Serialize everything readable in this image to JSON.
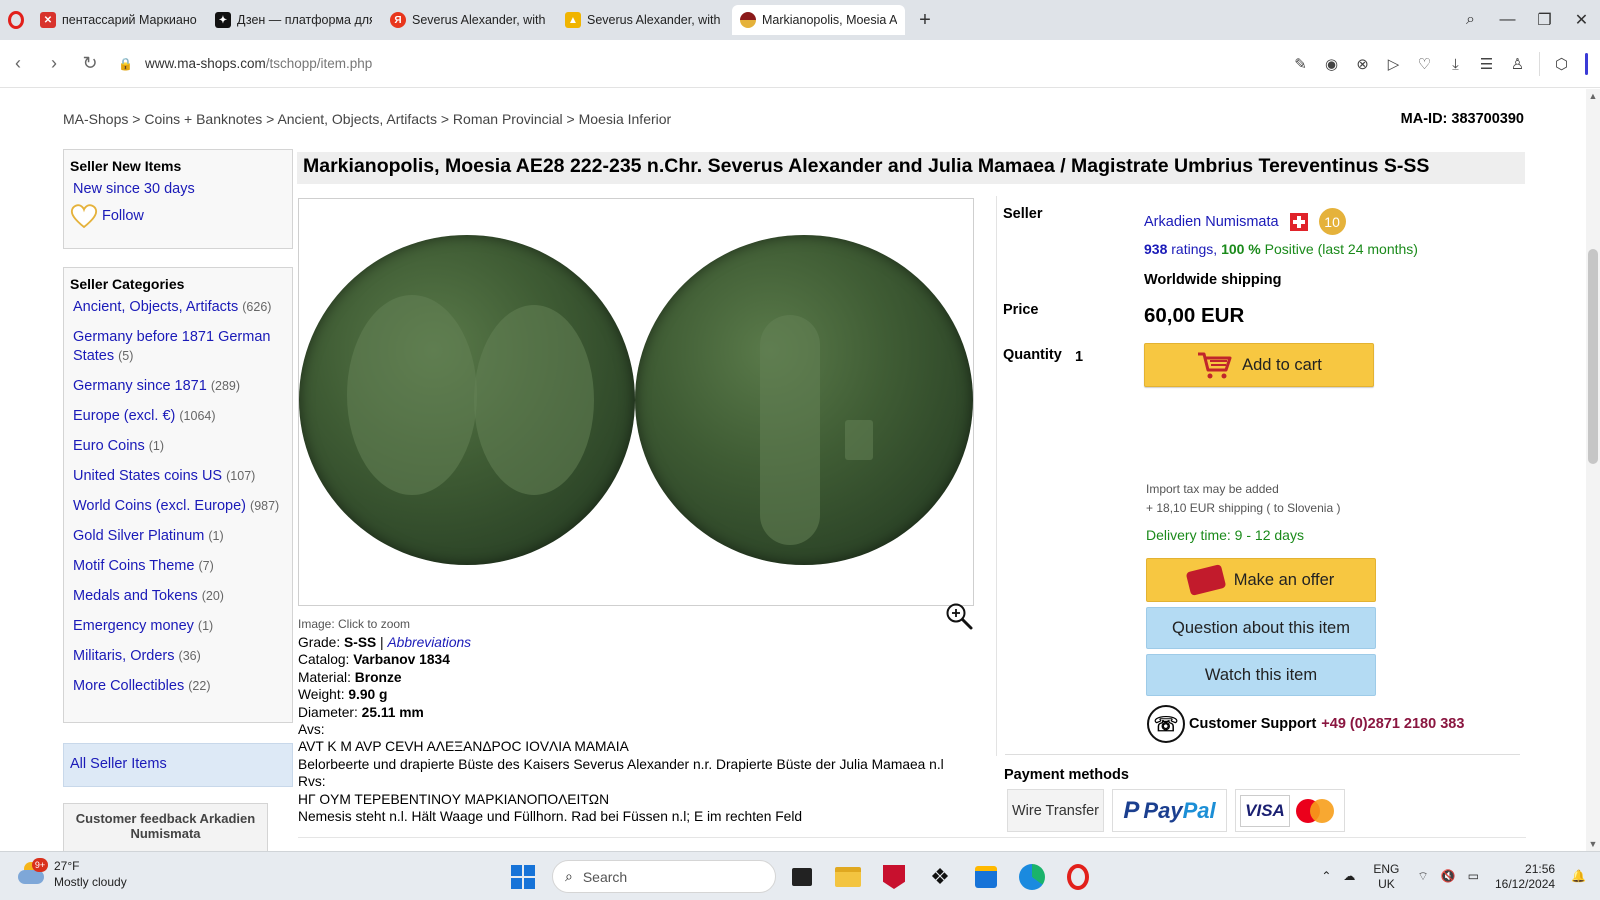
{
  "browser": {
    "tabs": [
      {
        "label": "пентассарий Маркиано",
        "favicon_color": "#d8332c",
        "active": false
      },
      {
        "label": "Дзен — платформа для п",
        "favicon_color": "#111111",
        "active": false
      },
      {
        "label": "Severus Alexander, with Ju",
        "favicon_color": "#e8361c",
        "active": false
      },
      {
        "label": "Severus Alexander, with Ju",
        "favicon_color": "#f0b400",
        "active": false
      },
      {
        "label": "Markianopolis, Moesia AE",
        "favicon_color": "#8b1a1a",
        "active": true
      }
    ],
    "url_host": "www.ma-shops.com",
    "url_path": "/tschopp/item.php"
  },
  "breadcrumb": {
    "items": [
      "MA-Shops",
      "Coins + Banknotes",
      "Ancient, Objects, Artifacts",
      "Roman Provincial",
      "Moesia Inferior"
    ],
    "separator": ">"
  },
  "ma_id": "MA-ID: 383700390",
  "seller_new_items": {
    "title": "Seller New Items",
    "new_since": "New since 30 days",
    "follow": "Follow"
  },
  "seller_categories": {
    "title": "Seller Categories",
    "items": [
      {
        "name": "Ancient, Objects, Artifacts",
        "count": "(626)"
      },
      {
        "name": "Germany before 1871 German States",
        "count": "(5)"
      },
      {
        "name": "Germany since 1871",
        "count": "(289)"
      },
      {
        "name": "Europe (excl. €)",
        "count": "(1064)"
      },
      {
        "name": "Euro Coins",
        "count": "(1)"
      },
      {
        "name": "United States coins US",
        "count": "(107)"
      },
      {
        "name": "World Coins (excl. Europe)",
        "count": "(987)"
      },
      {
        "name": "Gold Silver Platinum",
        "count": "(1)"
      },
      {
        "name": "Motif Coins Theme",
        "count": "(7)"
      },
      {
        "name": "Medals and Tokens",
        "count": "(20)"
      },
      {
        "name": "Emergency money",
        "count": "(1)"
      },
      {
        "name": "Militaris, Orders",
        "count": "(36)"
      },
      {
        "name": "More Collectibles",
        "count": "(22)"
      }
    ]
  },
  "all_seller_items": "All Seller Items",
  "customer_feedback": "Customer feedback Arkadien Numismata",
  "item": {
    "title": "Markianopolis, Moesia AE28 222-235 n.Chr. Severus Alexander and Julia Mamaea / Magistrate Umbrius Tereventinus S-SS",
    "image_caption": "Image: Click to zoom",
    "grade_label": "Grade: ",
    "grade_value": "S-SS",
    "grade_sep": " | ",
    "abbreviations": "Abbreviations",
    "catalog_label": "Catalog: ",
    "catalog_value": "Varbanov 1834",
    "material_label": "Material: ",
    "material_value": "Bronze",
    "weight_label": "Weight: ",
    "weight_value": "9.90 g",
    "diameter_label": "Diameter: ",
    "diameter_value": "25.11 mm",
    "avs_label": "Avs:",
    "avs_legend": "AVT K M AVP CEVH AΛEΞANΔPOC IOVΛIA MAMAIA",
    "avs_desc": "Belorbeerte und drapierte Büste des Kaisers Severus Alexander n.r. Drapierte Büste der Julia Mamaea n.l",
    "rvs_label": "Rvs:",
    "rvs_legend": "HΓ OYM TEPEBENTINOY MAPKIANOΠOΛEITΩN",
    "rvs_desc": "Nemesis steht n.l. Hält Waage und Füllhorn. Rad bei Füssen n.l; E im rechten Feld"
  },
  "seller": {
    "label": "Seller",
    "name": "Arkadien Numismata",
    "badge": "10",
    "ratings_count": "938",
    "ratings_word": " ratings, ",
    "positive_pct": "100 %",
    "positive_text": " Positive (last 24 months)",
    "worldwide": "Worldwide shipping"
  },
  "purchase": {
    "price_label": "Price",
    "price": "60,00 EUR",
    "quantity_label": "Quantity",
    "quantity": "1",
    "add_to_cart": "Add to cart",
    "import_tax": "Import tax may be added",
    "shipping": "+ 18,10 EUR shipping ( to Slovenia )",
    "delivery": "Delivery time: 9 - 12 days",
    "make_offer": "Make an offer",
    "question": "Question about this item",
    "watch": "Watch this item",
    "support_label": "Customer Support",
    "support_number": "+49 (0)2871 2180 383"
  },
  "payment": {
    "title": "Payment methods",
    "wire": "Wire Transfer",
    "paypal_1": "Pay",
    "paypal_2": "Pal",
    "visa": "VISA"
  },
  "taskbar": {
    "weather_badge": "9+",
    "temperature": "27°F",
    "condition": "Mostly cloudy",
    "search": "Search",
    "lang1": "ENG",
    "lang2": "UK",
    "time": "21:56",
    "date": "16/12/2024"
  },
  "colors": {
    "link": "#1a1ab8",
    "positive": "#1a8a1a",
    "cart_button": "#f7c741",
    "info_button": "#b4dbf3",
    "support_number": "#8a1640"
  }
}
